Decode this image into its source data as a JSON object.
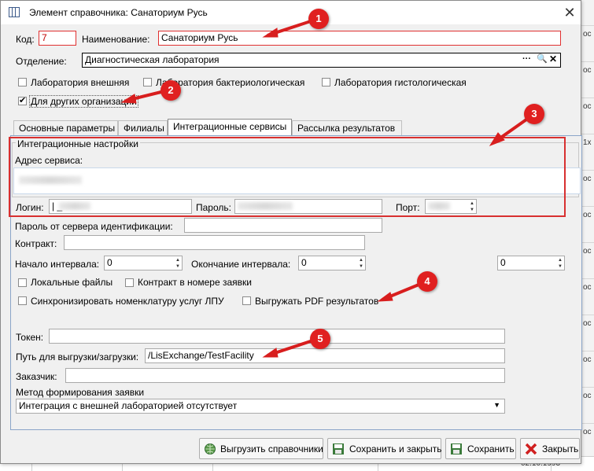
{
  "window": {
    "title": "Элемент справочника: Санаториум Русь",
    "close_glyph": "✕"
  },
  "header": {
    "code_label": "Код:",
    "code_value": "7",
    "name_label": "Наименование:",
    "name_value": "Санаториум Русь",
    "dept_label": "Отделение:",
    "dept_value": "Диагностическая лаборатория",
    "dept_actions": {
      "more": "···",
      "search": "🔍",
      "clear": "✕"
    }
  },
  "flags": [
    {
      "label": "Лаборатория внешняя",
      "checked": false
    },
    {
      "label": "Лаборатория бактериологическая",
      "checked": false
    },
    {
      "label": "Лаборатория гистологическая",
      "checked": false
    },
    {
      "label": "Для других организаций",
      "checked": true
    }
  ],
  "tabs": [
    {
      "label": "Основные параметры"
    },
    {
      "label": "Филиалы"
    },
    {
      "label": "Интеграционные сервисы",
      "active": true
    },
    {
      "label": "Рассылка результатов"
    }
  ],
  "integration": {
    "group_title": "Интеграционные настройки",
    "service_address_label": "Адрес сервиса:",
    "login_label": "Логин:",
    "login_value": "|  _",
    "password_label": "Пароль:",
    "port_label": "Порт:",
    "id_server_password_label": "Пароль от сервера идентификации:",
    "contract_label": "Контракт:",
    "interval_start_label": "Начало интервала:",
    "interval_start_value": "0",
    "interval_end_label": "Окончание интервала:",
    "interval_end_value": "0",
    "extra_value": "0",
    "options": [
      {
        "label": "Локальные файлы",
        "checked": false
      },
      {
        "label": "Контракт в номере заявки",
        "checked": false
      },
      {
        "label": "Синхронизировать номенклатуру услуг ЛПУ",
        "checked": false
      },
      {
        "label": "Выгружать PDF результатов",
        "checked": false
      }
    ],
    "token_label": "Токен:",
    "path_label": "Путь для выгрузки/загрузки:",
    "path_value": "/LisExchange/TestFacility",
    "customer_label": "Заказчик:",
    "method_label": "Метод формирования заявки",
    "method_value": "Интеграция с внешней лабораторией отсутствует"
  },
  "buttons": {
    "export_refs": "Выгрузить справочники",
    "save_close": "Сохранить и закрыть",
    "save": "Сохранить",
    "close": "Закрыть"
  },
  "markers": [
    "1",
    "2",
    "3",
    "4",
    "5"
  ],
  "background_snippets": {
    "right": [
      "ос",
      "ос",
      "ос",
      "1х",
      "ос",
      "ос",
      "ос",
      "ос",
      "ос",
      "ос",
      "ос",
      "ос"
    ],
    "bottom_date": "02.10.1993"
  },
  "colors": {
    "annotation": "#e02020",
    "tab_panel_border": "#8aa4c8",
    "input_border": "#a9a9a9"
  }
}
